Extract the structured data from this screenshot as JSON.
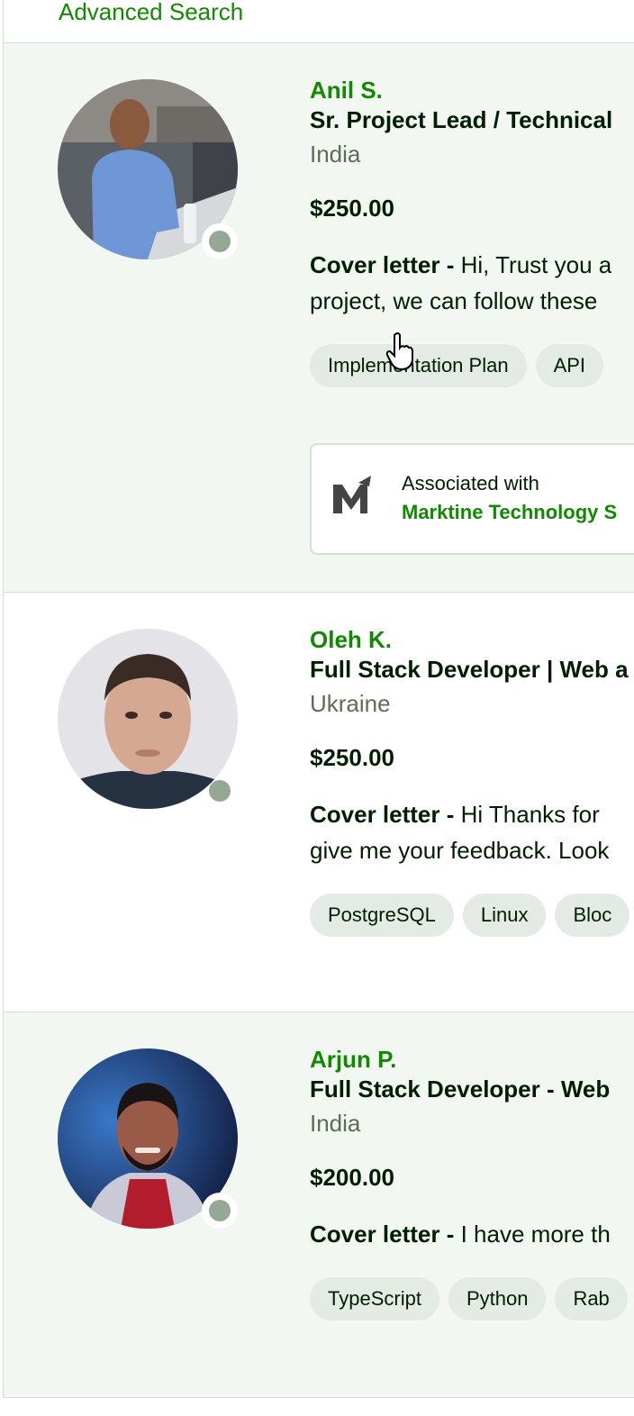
{
  "header": {
    "advanced_search_label": "Advanced Search"
  },
  "freelancers": [
    {
      "name": "Anil S.",
      "title": "Sr. Project Lead / Technical",
      "country": "India",
      "rate": "$250.00",
      "cover_label": "Cover letter - ",
      "cover_line1": "Hi, Trust you a",
      "cover_line2": "project, we can follow these",
      "skills": [
        "Implementation Plan",
        "API"
      ],
      "agency": {
        "label": "Associated with",
        "name": "Marktine Technology S"
      },
      "status": "offline",
      "avatar_icon": "person-in-blue-shirt-photo"
    },
    {
      "name": "Oleh K.",
      "title": "Full Stack Developer | Web a",
      "country": "Ukraine",
      "rate": "$250.00",
      "cover_label": "Cover letter - ",
      "cover_line1": "Hi Thanks for",
      "cover_line2": "give me your feedback. Look",
      "skills": [
        "PostgreSQL",
        "Linux",
        "Bloc"
      ],
      "status": "offline",
      "avatar_icon": "portrait-photo"
    },
    {
      "name": "Arjun P.",
      "title": "Full Stack Developer - Web",
      "country": "India",
      "rate": "$200.00",
      "cover_label": "Cover letter - ",
      "cover_line1": "I have more th",
      "skills": [
        "TypeScript",
        "Python",
        "Rab"
      ],
      "status": "offline",
      "avatar_icon": "portrait-photo-blue-light"
    }
  ],
  "colors": {
    "accent": "#108a00",
    "highlight_bg": "#f2f7f2",
    "chip_bg": "#e4ebe4",
    "status_dot": "#95a795"
  }
}
